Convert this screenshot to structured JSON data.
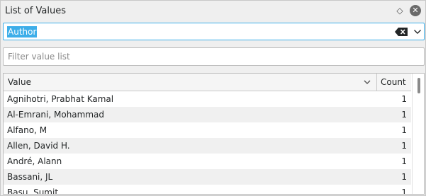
{
  "panel": {
    "title": "List of Values",
    "float_icon": "diamond-float-icon",
    "close_icon": "close-circle-icon"
  },
  "field_combo": {
    "value": "Author",
    "selection_color": "#3daee9",
    "clear_icon": "backspace-clear-icon",
    "dropdown_icon": "chevron-down-icon"
  },
  "filter": {
    "placeholder": "Filter value list",
    "value": ""
  },
  "table": {
    "columns": [
      "Value",
      "Count"
    ],
    "sort_icon": "chevron-down-icon",
    "rows": [
      {
        "value": "Agnihotri, Prabhat Kamal",
        "count": "1"
      },
      {
        "value": "Al-Emrani, Mohammad",
        "count": "1"
      },
      {
        "value": "Alfano, M",
        "count": "1"
      },
      {
        "value": "Allen, David H.",
        "count": "1"
      },
      {
        "value": "André, Alann",
        "count": "1"
      },
      {
        "value": "Bassani, JL",
        "count": "1"
      },
      {
        "value": "Basu, Sumit",
        "count": "1"
      }
    ]
  }
}
